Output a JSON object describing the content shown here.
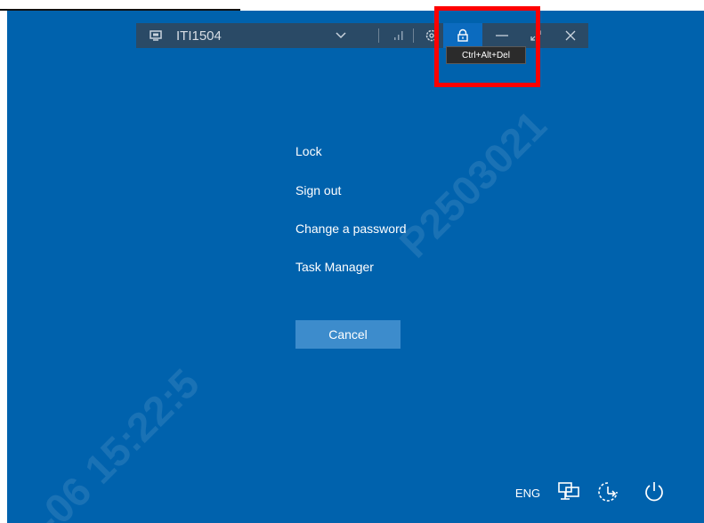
{
  "remote_bar": {
    "title": "ITI1504",
    "tooltip": "Ctrl+Alt+Del"
  },
  "menu": {
    "items": [
      "Lock",
      "Sign out",
      "Change a password",
      "Task Manager"
    ],
    "cancel_label": "Cancel"
  },
  "tray": {
    "language": "ENG"
  },
  "watermark": {
    "line1": "P2503021",
    "line2": "-06 15:22:5"
  },
  "colors": {
    "background": "#0062ad",
    "remote_bar": "#2a4a66",
    "cancel_button": "#3d8ccc",
    "highlight": "#ff0000"
  }
}
